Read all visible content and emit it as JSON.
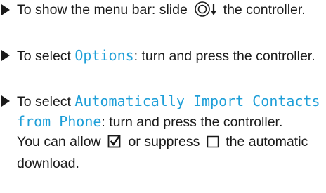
{
  "steps": [
    {
      "before": "To show the menu bar: slide",
      "after": "the controller."
    },
    {
      "before": "To select ",
      "selection": "Options",
      "after": ": turn and press the controller."
    },
    {
      "before": "To select ",
      "selection": "Automatically Import Contacts from Phone",
      "after": ": turn and press the controller."
    }
  ],
  "note": {
    "part1": "You can allow",
    "part2": "or suppress",
    "part3": "the automatic download."
  },
  "icons": {
    "controller": "controller-slide-down-icon",
    "checked": "checked-box-icon",
    "unchecked": "unchecked-box-icon"
  },
  "colors": {
    "selection": "#1f9fd8",
    "text": "#1a1a1a"
  }
}
